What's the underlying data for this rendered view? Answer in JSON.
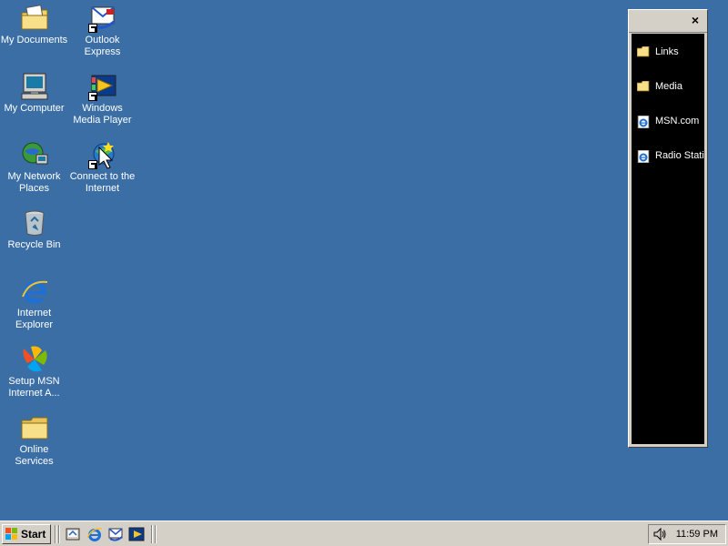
{
  "desktop": {
    "icons": [
      {
        "label": "My Documents",
        "icon": "my-documents-icon"
      },
      {
        "label": "Outlook\nExpress",
        "icon": "outlook-express-icon"
      },
      {
        "label": "My Computer",
        "icon": "my-computer-icon"
      },
      {
        "label": "Windows\nMedia Player",
        "icon": "windows-media-player-icon"
      },
      {
        "label": "My Network\nPlaces",
        "icon": "network-places-icon"
      },
      {
        "label": "Connect to the\nInternet",
        "icon": "connect-internet-icon"
      },
      {
        "label": "Recycle Bin",
        "icon": "recycle-bin-icon"
      },
      {
        "label": "Internet\nExplorer",
        "icon": "internet-explorer-icon"
      },
      {
        "label": "Setup MSN\nInternet A...",
        "icon": "msn-setup-icon"
      },
      {
        "label": "Online\nServices",
        "icon": "folder-icon"
      }
    ]
  },
  "channel_bar": {
    "close_label": "×",
    "items": [
      {
        "label": "Links",
        "icon": "folder-icon"
      },
      {
        "label": "Media",
        "icon": "folder-icon"
      },
      {
        "label": "MSN.com",
        "icon": "ie-page-icon"
      },
      {
        "label": "Radio Statio",
        "icon": "ie-page-icon"
      }
    ]
  },
  "taskbar": {
    "start_label": "Start",
    "quick_launch": [
      {
        "icon": "show-desktop-icon"
      },
      {
        "icon": "internet-explorer-icon"
      },
      {
        "icon": "outlook-express-icon"
      },
      {
        "icon": "windows-media-player-icon"
      }
    ],
    "clock": "11:59 PM"
  },
  "colors": {
    "desktop": "#3a6ea5",
    "face": "#d4d0c8",
    "channel_bg": "#000000"
  }
}
